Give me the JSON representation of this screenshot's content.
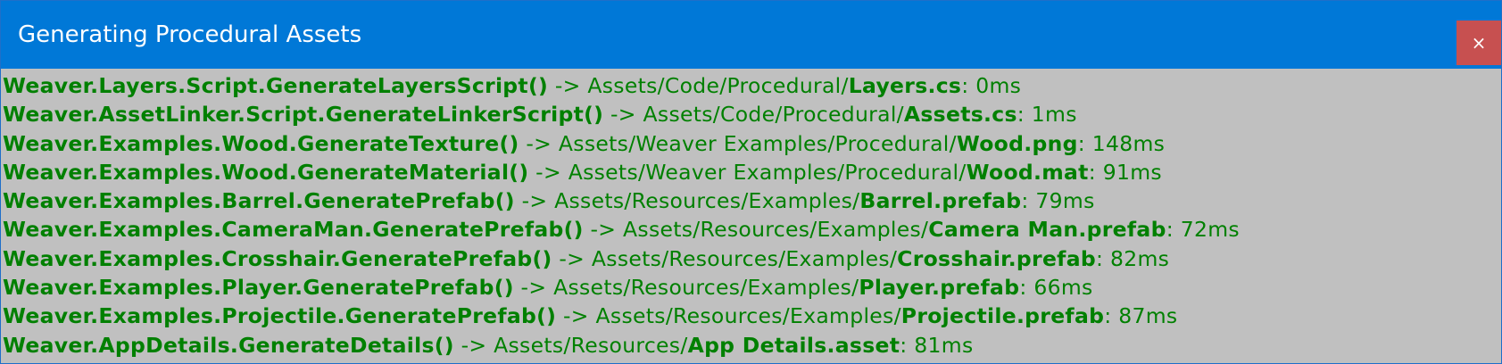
{
  "window": {
    "title": "Generating Procedural Assets",
    "close_label": "×",
    "titlebar_color": "#0078d7",
    "close_color": "#c75050",
    "background_color": "#c0c0c0",
    "text_color": "#008000"
  },
  "log": {
    "lines": [
      {
        "method": "Weaver.Layers.Script.GenerateLayersScript()",
        "arrow": " -> ",
        "path": "Assets/Code/Procedural/",
        "file": "Layers.cs",
        "time": ": 0ms"
      },
      {
        "method": "Weaver.AssetLinker.Script.GenerateLinkerScript()",
        "arrow": " -> ",
        "path": "Assets/Code/Procedural/",
        "file": "Assets.cs",
        "time": ": 1ms"
      },
      {
        "method": "Weaver.Examples.Wood.GenerateTexture()",
        "arrow": " -> ",
        "path": "Assets/Weaver Examples/Procedural/",
        "file": "Wood.png",
        "time": ": 148ms"
      },
      {
        "method": "Weaver.Examples.Wood.GenerateMaterial()",
        "arrow": " -> ",
        "path": "Assets/Weaver Examples/Procedural/",
        "file": "Wood.mat",
        "time": ": 91ms"
      },
      {
        "method": "Weaver.Examples.Barrel.GeneratePrefab()",
        "arrow": " -> ",
        "path": "Assets/Resources/Examples/",
        "file": "Barrel.prefab",
        "time": ": 79ms"
      },
      {
        "method": "Weaver.Examples.CameraMan.GeneratePrefab()",
        "arrow": " -> ",
        "path": "Assets/Resources/Examples/",
        "file": "Camera Man.prefab",
        "time": ": 72ms"
      },
      {
        "method": "Weaver.Examples.Crosshair.GeneratePrefab()",
        "arrow": " -> ",
        "path": "Assets/Resources/Examples/",
        "file": "Crosshair.prefab",
        "time": ": 82ms"
      },
      {
        "method": "Weaver.Examples.Player.GeneratePrefab()",
        "arrow": " -> ",
        "path": "Assets/Resources/Examples/",
        "file": "Player.prefab",
        "time": ": 66ms"
      },
      {
        "method": "Weaver.Examples.Projectile.GeneratePrefab()",
        "arrow": " -> ",
        "path": "Assets/Resources/Examples/",
        "file": "Projectile.prefab",
        "time": ": 87ms"
      },
      {
        "method": "Weaver.AppDetails.GenerateDetails()",
        "arrow": " -> ",
        "path": "Assets/Resources/",
        "file": "App Details.asset",
        "time": ": 81ms"
      }
    ]
  }
}
